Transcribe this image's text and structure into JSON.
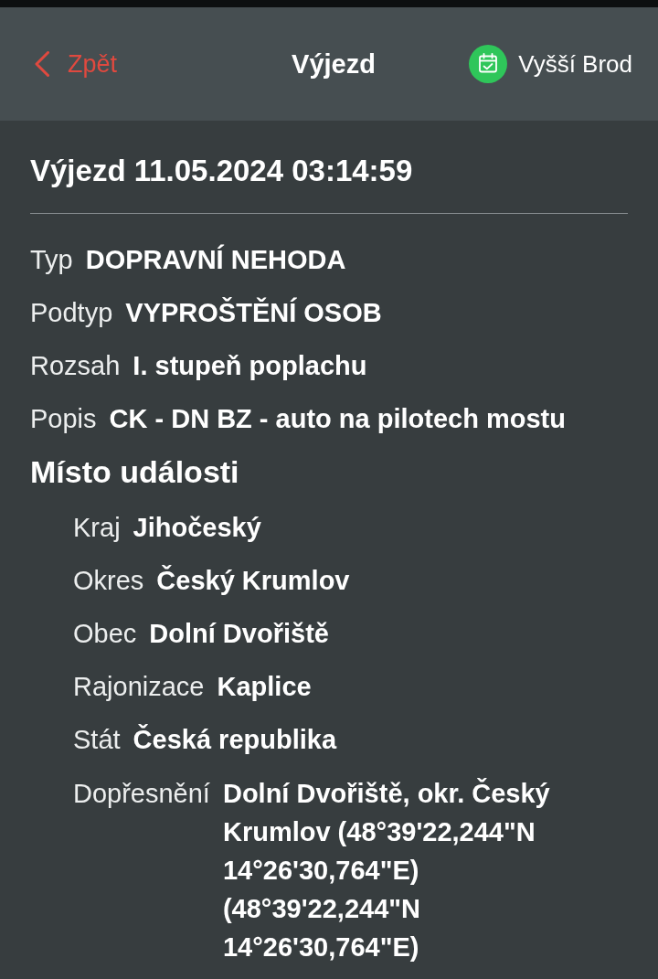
{
  "header": {
    "back_label": "Zpět",
    "title": "Výjezd",
    "station": "Vyšší Brod"
  },
  "event": {
    "title": "Výjezd 11.05.2024 03:14:59",
    "fields": [
      {
        "label": "Typ",
        "value": "DOPRAVNÍ NEHODA"
      },
      {
        "label": "Podtyp",
        "value": "VYPROŠTĚNÍ OSOB"
      },
      {
        "label": "Rozsah",
        "value": "I. stupeň poplachu"
      },
      {
        "label": "Popis",
        "value": "CK - DN BZ - auto na pilotech mostu"
      }
    ]
  },
  "location": {
    "heading": "Místo události",
    "fields": [
      {
        "label": "Kraj",
        "value": "Jihočeský"
      },
      {
        "label": "Okres",
        "value": "Český Krumlov"
      },
      {
        "label": "Obec",
        "value": "Dolní Dvořiště"
      },
      {
        "label": "Rajonizace",
        "value": "Kaplice"
      },
      {
        "label": "Stát",
        "value": "Česká republika"
      },
      {
        "label": "Dopřesnění",
        "value": "Dolní Dvořiště, okr. Český Krumlov (48°39'22,244\"N 14°26'30,764\"E) (48°39'22,244\"N 14°26'30,764\"E)"
      }
    ]
  }
}
